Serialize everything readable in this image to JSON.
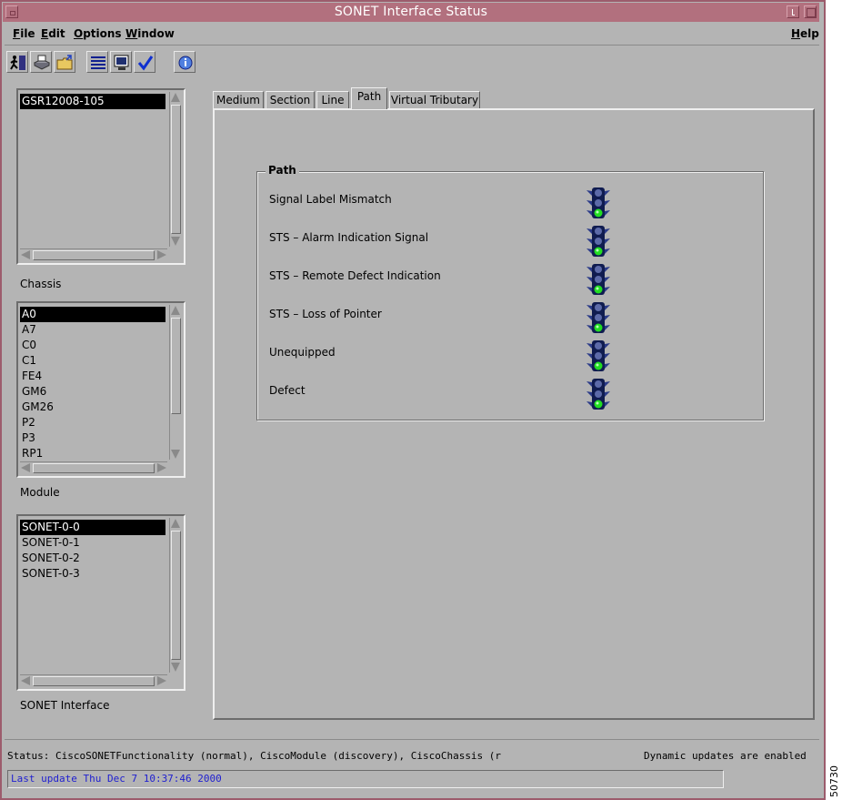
{
  "window": {
    "title": "SONET Interface Status"
  },
  "menubar": {
    "items": [
      {
        "mnemonic": "F",
        "rest": "ile"
      },
      {
        "mnemonic": "E",
        "rest": "dit"
      },
      {
        "mnemonic": "O",
        "rest": "ptions"
      },
      {
        "mnemonic": "W",
        "rest": "indow"
      }
    ],
    "help": {
      "mnemonic": "H",
      "rest": "elp"
    }
  },
  "toolbar": {
    "icons": [
      "exit-icon",
      "print-icon",
      "open-folder-icon",
      "list-view-icon",
      "monitor-icon",
      "checkmark-icon",
      "info-icon"
    ]
  },
  "lists": {
    "devices": {
      "items": [
        "GSR12008-105"
      ],
      "selected": 0
    },
    "chassis": {
      "label": "Chassis",
      "items": [
        "A0",
        "A7",
        "C0",
        "C1",
        "FE4",
        "GM6",
        "GM26",
        "P2",
        "P3",
        "RP1"
      ],
      "selected": 0
    },
    "module": {
      "label": "Module",
      "items": [
        "SONET-0-0",
        "SONET-0-1",
        "SONET-0-2",
        "SONET-0-3"
      ],
      "selected": 0
    },
    "interface": {
      "label": "SONET Interface"
    }
  },
  "tabs": [
    {
      "label": "Medium"
    },
    {
      "label": "Section"
    },
    {
      "label": "Line"
    },
    {
      "label": "Path",
      "active": true
    },
    {
      "label": "Virtual Tributary"
    }
  ],
  "path_group": {
    "title": "Path",
    "rows": [
      {
        "label": "Signal Label Mismatch",
        "status": "green"
      },
      {
        "label": "STS – Alarm Indication Signal",
        "status": "green"
      },
      {
        "label": "STS – Remote Defect Indication",
        "status": "green"
      },
      {
        "label": "STS – Loss of Pointer",
        "status": "green"
      },
      {
        "label": "Unequipped",
        "status": "green"
      },
      {
        "label": "Defect",
        "status": "green"
      }
    ]
  },
  "status": {
    "text": "Status: CiscoSONETFunctionality (normal), CiscoModule (discovery), CiscoChassis (r",
    "updates": "Dynamic updates are enabled",
    "last_update": "Last update Thu Dec  7 10:37:46 2000"
  },
  "figure_number": "50730"
}
